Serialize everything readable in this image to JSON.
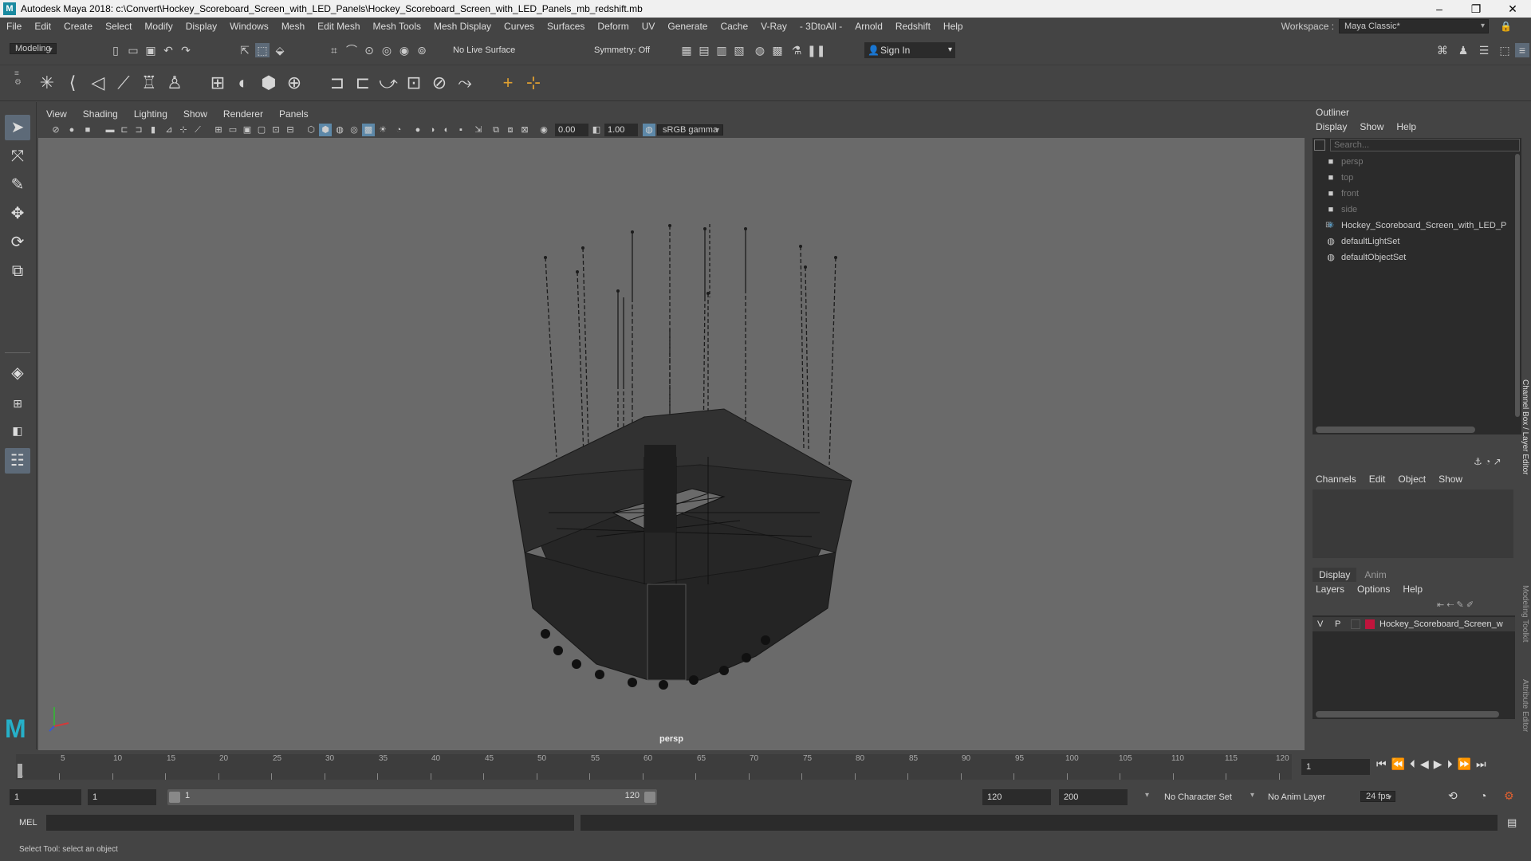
{
  "window": {
    "title": "Autodesk Maya 2018: c:\\Convert\\Hockey_Scoreboard_Screen_with_LED_Panels\\Hockey_Scoreboard_Screen_with_LED_Panels_mb_redshift.mb",
    "minimize": "–",
    "maximize": "❐",
    "close": "✕"
  },
  "menubar": {
    "items": [
      "File",
      "Edit",
      "Create",
      "Select",
      "Modify",
      "Display",
      "Windows",
      "Mesh",
      "Edit Mesh",
      "Mesh Tools",
      "Mesh Display",
      "Curves",
      "Surfaces",
      "Deform",
      "UV",
      "Generate",
      "Cache",
      "V-Ray",
      "- 3DtoAll -",
      "Arnold",
      "Redshift",
      "Help"
    ],
    "workspace_label": "Workspace :",
    "workspace_value": "Maya Classic*"
  },
  "statusline": {
    "mode": "Modeling",
    "live_surface": "No Live Surface",
    "symmetry": "Symmetry: Off",
    "sign_in": "Sign In"
  },
  "viewport": {
    "menus": [
      "View",
      "Shading",
      "Lighting",
      "Show",
      "Renderer",
      "Panels"
    ],
    "exposure": "0.00",
    "gamma": "1.00",
    "color_space": "sRGB gamma",
    "camera_label": "persp"
  },
  "outliner": {
    "title": "Outliner",
    "menus": [
      "Display",
      "Show",
      "Help"
    ],
    "search_placeholder": "Search...",
    "items": [
      {
        "label": "persp",
        "dim": true,
        "icon": "camera-icon"
      },
      {
        "label": "top",
        "dim": true,
        "icon": "camera-icon"
      },
      {
        "label": "front",
        "dim": true,
        "icon": "camera-icon"
      },
      {
        "label": "side",
        "dim": true,
        "icon": "camera-icon"
      },
      {
        "label": "Hockey_Scoreboard_Screen_with_LED_P",
        "dim": false,
        "icon": "transform-icon"
      },
      {
        "label": "defaultLightSet",
        "dim": false,
        "icon": "set-icon"
      },
      {
        "label": "defaultObjectSet",
        "dim": false,
        "icon": "set-icon"
      }
    ]
  },
  "channelbox": {
    "menus": [
      "Channels",
      "Edit",
      "Object",
      "Show"
    ],
    "side_tab_1": "Channel Box / Layer Editor",
    "side_tab_2": "Modeling Toolkit",
    "side_tab_3": "Attribute Editor"
  },
  "layers": {
    "tabs": [
      "Display",
      "Anim"
    ],
    "menus": [
      "Layers",
      "Options",
      "Help"
    ],
    "row": {
      "v": "V",
      "p": "P",
      "name": "Hockey_Scoreboard_Screen_w",
      "color": "#c0143c"
    }
  },
  "timeline": {
    "ticks": [
      "5",
      "10",
      "15",
      "20",
      "25",
      "30",
      "35",
      "40",
      "45",
      "50",
      "55",
      "60",
      "65",
      "70",
      "75",
      "80",
      "85",
      "90",
      "95",
      "100",
      "105",
      "110",
      "115",
      "120"
    ],
    "start_marker": "1",
    "current_frame": "1"
  },
  "range": {
    "start": "1",
    "playback_start": "1",
    "slider_start": "1",
    "slider_end": "120",
    "playback_end": "120",
    "end": "200",
    "character_set": "No Character Set",
    "anim_layer": "No Anim Layer",
    "fps": "24 fps"
  },
  "command": {
    "language": "MEL"
  },
  "help": {
    "text": "Select Tool: select an object"
  }
}
